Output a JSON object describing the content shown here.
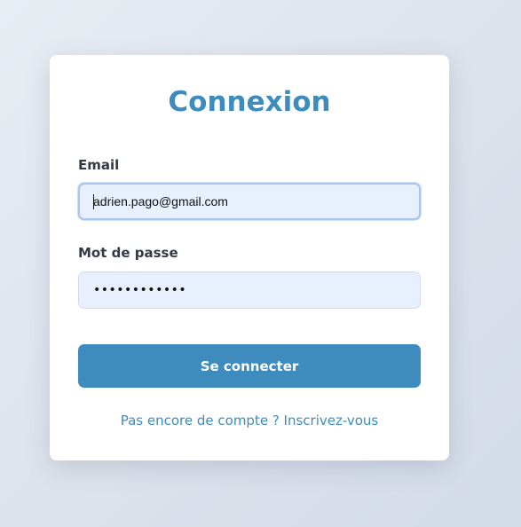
{
  "login": {
    "title": "Connexion",
    "email_label": "Email",
    "email_value": "adrien.pago@gmail.com",
    "password_label": "Mot de passe",
    "password_mask": "••••••••••••",
    "submit_label": "Se connecter",
    "signup_link": "Pas encore de compte ? Inscrivez-vous"
  },
  "colors": {
    "accent": "#3d8cbd",
    "input_background": "#e8f0fe",
    "focus_border": "#a9c7ee"
  }
}
